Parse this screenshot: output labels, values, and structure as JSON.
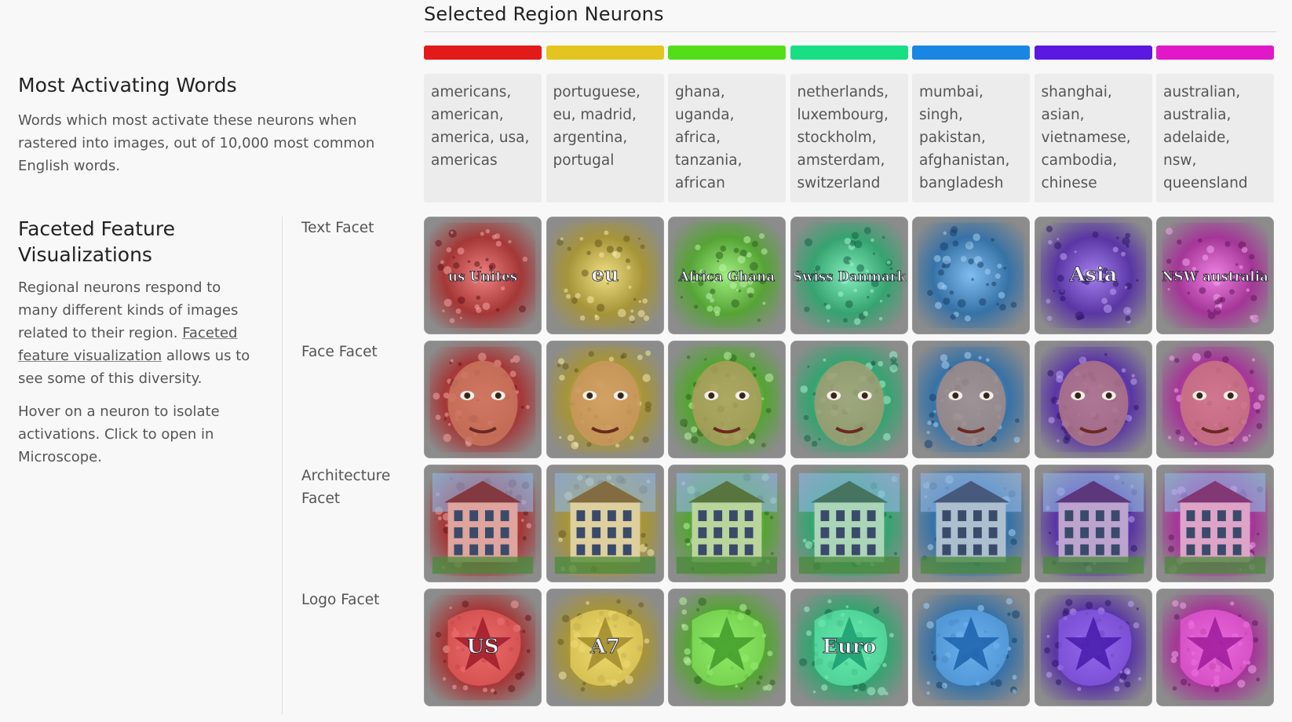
{
  "header": {
    "title": "Selected Region Neurons"
  },
  "neurons": [
    {
      "color": "#e21a1a",
      "words": "americans, american, america, usa, americas"
    },
    {
      "color": "#e4c41e",
      "words": "portuguese, eu, madrid, argentina, portugal"
    },
    {
      "color": "#52de18",
      "words": "ghana, uganda, africa, tanzania, african"
    },
    {
      "color": "#18de84",
      "words": "netherlands, luxembourg, stockholm, amsterdam, switzerland"
    },
    {
      "color": "#1a86e4",
      "words": "mumbai, singh, pakistan, afghanistan, bangladesh"
    },
    {
      "color": "#5a18e0",
      "words": "shanghai, asian, vietnamese, cambodia, chinese"
    },
    {
      "color": "#e018c8",
      "words": "australian, australia, adelaide, nsw, queensland"
    }
  ],
  "most_activating": {
    "title": "Most Activating Words",
    "description": "Words which most activate these neurons when rastered into images, out of 10,000 most common English words."
  },
  "faceted": {
    "title": "Faceted Feature Visualizations",
    "desc_before": "Regional neurons respond to many different kinds of images related to their region. ",
    "link_text": "Faceted feature visualization",
    "desc_after": " allows us to see some of this diversity.",
    "hover_note": "Hover on a neuron to isolate activations. Click to open in Microscope."
  },
  "facets": [
    {
      "label": "Text Facet",
      "tile_texts": [
        "us Unites",
        "eu",
        "Africa Ghana",
        "Swiss Danmark",
        "",
        "Asia",
        "NSW australia"
      ]
    },
    {
      "label": "Face Facet",
      "tile_texts": [
        "",
        "",
        "",
        "",
        "",
        "",
        ""
      ]
    },
    {
      "label": "Architecture Facet",
      "tile_texts": [
        "",
        "",
        "",
        "",
        "",
        "",
        ""
      ]
    },
    {
      "label": "Logo Facet",
      "tile_texts": [
        "US",
        "A7",
        "",
        "Euro",
        "",
        "",
        ""
      ]
    }
  ]
}
